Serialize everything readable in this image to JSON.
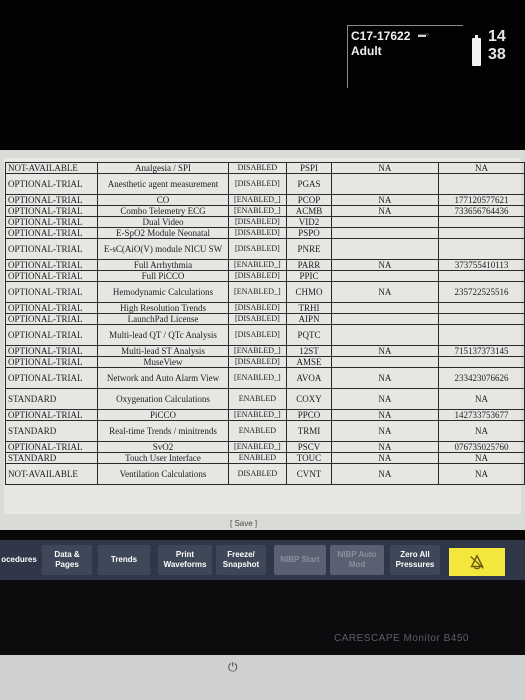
{
  "status_bar": {
    "patient_id": "C17-17622",
    "patient_type": "Adult",
    "clock": "14 38",
    "signal_icon": "signal-icon",
    "battery_icon": "battery-icon"
  },
  "options_table": {
    "rows": [
      {
        "type": "NOT-AVAILABLE",
        "name": "Analgesia / SPI",
        "state": "DISABLED",
        "code": "PSPI",
        "value1": "NA",
        "value2": "NA"
      },
      {
        "type": "OPTIONAL-TRIAL",
        "name": "Anesthetic agent measurement",
        "state": "[DISABLED]",
        "code": "PGAS",
        "value1": "",
        "value2": ""
      },
      {
        "type": "OPTIONAL-TRIAL",
        "name": "CO",
        "state": "[ENABLED_]",
        "code": "PCOP",
        "value1": "NA",
        "value2": "177120577621"
      },
      {
        "type": "OPTIONAL-TRIAL",
        "name": "Combo Telemetry ECG",
        "state": "[ENABLED_]",
        "code": "ACMB",
        "value1": "NA",
        "value2": "733656764436"
      },
      {
        "type": "OPTIONAL-TRIAL",
        "name": "Dual Video",
        "state": "[DISABLED]",
        "code": "VID2",
        "value1": "",
        "value2": ""
      },
      {
        "type": "OPTIONAL-TRIAL",
        "name": "E-SpO2 Module Neonatal",
        "state": "[DISABLED]",
        "code": "PSPO",
        "value1": "",
        "value2": ""
      },
      {
        "type": "OPTIONAL-TRIAL",
        "name": "E-sC(AiO(V) module NICU SW",
        "state": "[DISABLED]",
        "code": "PNRE",
        "value1": "",
        "value2": ""
      },
      {
        "type": "OPTIONAL-TRIAL",
        "name": "Full Arrhythmia",
        "state": "[ENABLED_]",
        "code": "PARR",
        "value1": "NA",
        "value2": "373755410113"
      },
      {
        "type": "OPTIONAL-TRIAL",
        "name": "Full PiCCO",
        "state": "[DISABLED]",
        "code": "PPIC",
        "value1": "",
        "value2": ""
      },
      {
        "type": "OPTIONAL-TRIAL",
        "name": "Hemodynamic Calculations",
        "state": "[ENABLED_]",
        "code": "CHMO",
        "value1": "NA",
        "value2": "235722525516"
      },
      {
        "type": "OPTIONAL-TRIAL",
        "name": "High Resolution Trends",
        "state": "[DISABLED]",
        "code": "TRHI",
        "value1": "",
        "value2": ""
      },
      {
        "type": "OPTIONAL-TRIAL",
        "name": "LaunchPad License",
        "state": "[DISABLED]",
        "code": "AIPN",
        "value1": "",
        "value2": ""
      },
      {
        "type": "OPTIONAL-TRIAL",
        "name": "Multi-lead QT / QTc Analysis",
        "state": "[DISABLED]",
        "code": "PQTC",
        "value1": "",
        "value2": ""
      },
      {
        "type": "OPTIONAL-TRIAL",
        "name": "Multi-lead ST Analysis",
        "state": "[ENABLED_]",
        "code": "12ST",
        "value1": "NA",
        "value2": "715137373145"
      },
      {
        "type": "OPTIONAL-TRIAL",
        "name": "MuseView",
        "state": "[DISABLED]",
        "code": "AMSE",
        "value1": "",
        "value2": ""
      },
      {
        "type": "OPTIONAL-TRIAL",
        "name": "Network and Auto Alarm View",
        "state": "[ENABLED_]",
        "code": "AVOA",
        "value1": "NA",
        "value2": "233423076626"
      },
      {
        "type": "STANDARD",
        "name": "Oxygenation Calculations",
        "state": "ENABLED",
        "code": "COXY",
        "value1": "NA",
        "value2": "NA"
      },
      {
        "type": "OPTIONAL-TRIAL",
        "name": "PiCCO",
        "state": "[ENABLED_]",
        "code": "PPCO",
        "value1": "NA",
        "value2": "142733753677"
      },
      {
        "type": "STANDARD",
        "name": "Real-time Trends / minitrends",
        "state": "ENABLED",
        "code": "TRMI",
        "value1": "NA",
        "value2": "NA"
      },
      {
        "type": "OPTIONAL-TRIAL",
        "name": "SvO2",
        "state": "[ENABLED_]",
        "code": "PSCV",
        "value1": "NA",
        "value2": "076735025760"
      },
      {
        "type": "STANDARD",
        "name": "Touch User Interface",
        "state": "ENABLED",
        "code": "TOUC",
        "value1": "NA",
        "value2": "NA"
      },
      {
        "type": "NOT-AVAILABLE",
        "name": "Ventilation Calculations",
        "state": "DISABLED",
        "code": "CVNT",
        "value1": "NA",
        "value2": "NA"
      }
    ]
  },
  "save_label": "[ Save ]",
  "toolbar": {
    "procedures": "ocedures",
    "data_pages": "Data & Pages",
    "trends": "Trends",
    "print_waveforms": "Print Waveforms",
    "freeze_snapshot": "Freeze/ Snapshot",
    "nibp_start": "NIBP Start",
    "nibp_auto": "NIBP Auto Mod",
    "zero_all": "Zero All Pressures",
    "alarm_icon": "alarm-silence-icon"
  },
  "brand": "CARESCAPE Monitor B450"
}
